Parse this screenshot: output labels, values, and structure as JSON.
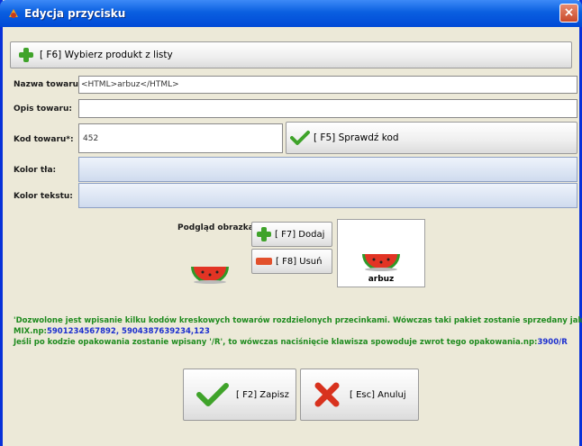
{
  "window": {
    "title": "Edycja przycisku",
    "close_glyph": "×"
  },
  "toolbar": {
    "select_product_label": "[ F6] Wybierz produkt z listy"
  },
  "form": {
    "name_label": "Nazwa towaru:",
    "name_value": "<HTML>arbuz</HTML>",
    "description_label": "Opis towaru:",
    "description_value": "",
    "code_label": "Kod towaru*:",
    "code_value": "452",
    "check_code_label": "[ F5] Sprawdź kod",
    "bg_color_label": "Kolor tła:",
    "text_color_label": "Kolor tekstu:"
  },
  "preview": {
    "label": "Podgląd obrazka:",
    "add_label": "[ F7] Dodaj",
    "remove_label": "[ F8] Usuń",
    "caption": "arbuz"
  },
  "info": {
    "line1": "'Dozwolone jest wpisanie kilku kodów kreskowych towarów rozdzielonych przecinkami. Wówczas taki pakiet zostanie sprzedany jako",
    "line2_prefix": "MIX.np:",
    "line2_highlight": "5901234567892, 5904387639234,123",
    "line3_prefix": "Jeśli po kodzie opakowania zostanie wpisany '/R', to wówczas naciśnięcie klawisza spowoduje zwrot tego opakowania.np:",
    "line3_highlight": "3900/R"
  },
  "actions": {
    "save_label": "[ F2] Zapisz",
    "cancel_label": "[ Esc] Anuluj"
  },
  "colors": {
    "titlebar": "#0a5fe0",
    "info_text": "#1f8b1f",
    "info_highlight": "#1c2fcf",
    "color_field": "#cfdbee"
  }
}
